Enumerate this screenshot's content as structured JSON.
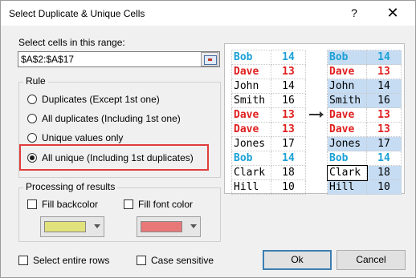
{
  "title": "Select Duplicate & Unique Cells",
  "help_label": "?",
  "close_label": "✕",
  "range": {
    "label": "Select cells in this range:",
    "value": "$A$2:$A$17"
  },
  "rule": {
    "title": "Rule",
    "options": [
      {
        "label": "Duplicates (Except 1st one)",
        "checked": false
      },
      {
        "label": "All duplicates (Including 1st one)",
        "checked": false
      },
      {
        "label": "Unique values only",
        "checked": false
      },
      {
        "label": "All unique (Including 1st duplicates)",
        "checked": true
      }
    ]
  },
  "processing": {
    "title": "Processing of results",
    "fill_backcolor": {
      "label": "Fill backcolor",
      "checked": false,
      "color": "#e2e27c"
    },
    "fill_fontcolor": {
      "label": "Fill font color",
      "checked": false,
      "color": "#e87878"
    }
  },
  "select_entire_rows": {
    "label": "Select entire rows",
    "checked": false
  },
  "case_sensitive": {
    "label": "Case sensitive",
    "checked": false
  },
  "ok_label": "Ok",
  "cancel_label": "Cancel",
  "preview": {
    "before": [
      {
        "name": "Bob",
        "num": "14",
        "color": "#1ba1d6",
        "bold": true
      },
      {
        "name": "Dave",
        "num": "13",
        "color": "#e02020",
        "bold": true
      },
      {
        "name": "John",
        "num": "14",
        "color": "#000000",
        "bold": false
      },
      {
        "name": "Smith",
        "num": "16",
        "color": "#000000",
        "bold": false
      },
      {
        "name": "Dave",
        "num": "13",
        "color": "#e02020",
        "bold": true
      },
      {
        "name": "Dave",
        "num": "13",
        "color": "#e02020",
        "bold": true
      },
      {
        "name": "Jones",
        "num": "17",
        "color": "#000000",
        "bold": false
      },
      {
        "name": "Bob",
        "num": "14",
        "color": "#1ba1d6",
        "bold": true
      },
      {
        "name": "Clark",
        "num": "18",
        "color": "#000000",
        "bold": false
      },
      {
        "name": "Hill",
        "num": "10",
        "color": "#000000",
        "bold": false
      }
    ],
    "after": [
      {
        "name": "Bob",
        "num": "14",
        "color": "#1ba1d6",
        "bold": true,
        "selected": true
      },
      {
        "name": "Dave",
        "num": "13",
        "color": "#e02020",
        "bold": true,
        "selected": false
      },
      {
        "name": "John",
        "num": "14",
        "color": "#000000",
        "bold": false,
        "selected": true
      },
      {
        "name": "Smith",
        "num": "16",
        "color": "#000000",
        "bold": false,
        "selected": true
      },
      {
        "name": "Dave",
        "num": "13",
        "color": "#e02020",
        "bold": true,
        "selected": false
      },
      {
        "name": "Dave",
        "num": "13",
        "color": "#e02020",
        "bold": true,
        "selected": false
      },
      {
        "name": "Jones",
        "num": "17",
        "color": "#000000",
        "bold": false,
        "selected": true
      },
      {
        "name": "Bob",
        "num": "14",
        "color": "#1ba1d6",
        "bold": true,
        "selected": false
      },
      {
        "name": "Clark",
        "num": "18",
        "color": "#000000",
        "bold": false,
        "selected": true,
        "active": true
      },
      {
        "name": "Hill",
        "num": "10",
        "color": "#000000",
        "bold": false,
        "selected": true
      }
    ],
    "selection_color": "#c5dcf3"
  }
}
